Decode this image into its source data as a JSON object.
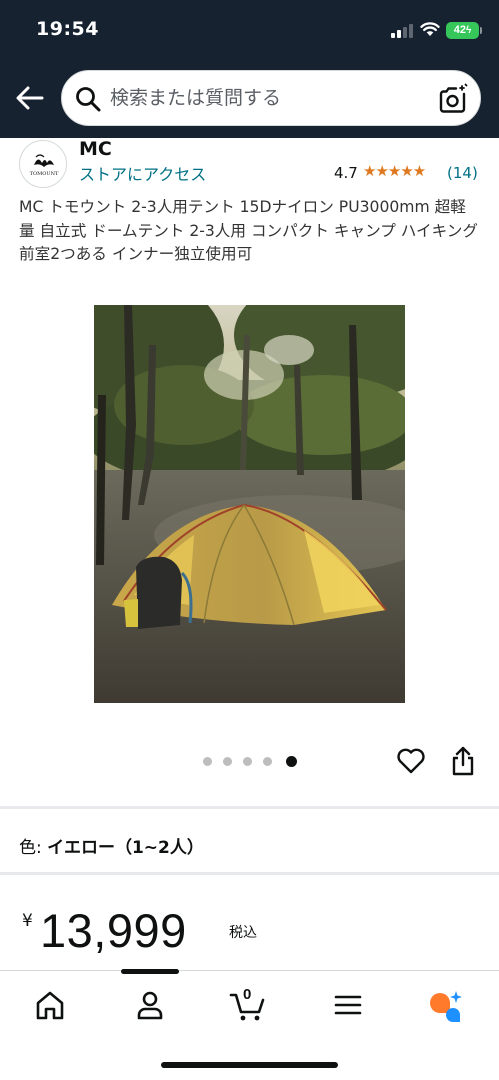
{
  "status_bar": {
    "time": "19:54",
    "battery": "42"
  },
  "search": {
    "placeholder": "検索または質問する"
  },
  "store": {
    "logo_text": "TOMOUNT",
    "brand": "MC",
    "visit_link": "ストアにアクセス",
    "rating": "4.7",
    "stars": "★★★★★",
    "review_count": "(14)"
  },
  "product": {
    "title": "MC トモウント 2-3人用テント 15Dナイロン PU3000mm 超軽量 自立式 ドームテント 2-3人用 コンパクト キャンプ ハイキング 前室2つある インナー独立使用可",
    "image_count": 5,
    "active_image_index": 4,
    "color_label": "色:",
    "color_value": "イエロー（1~2人）",
    "price_symbol": "¥",
    "price": "13,999",
    "tax_note": "税込"
  },
  "bottom_nav": {
    "items": [
      "home-icon",
      "account-icon",
      "cart-icon",
      "menu-icon",
      "rufus-icon"
    ],
    "cart_count": "0"
  },
  "colors": {
    "header_bg": "#172231",
    "link": "#007185",
    "star": "#de7921",
    "battery": "#35c759",
    "rufus_orange": "#ff7a2b",
    "rufus_blue": "#1e90ff"
  }
}
